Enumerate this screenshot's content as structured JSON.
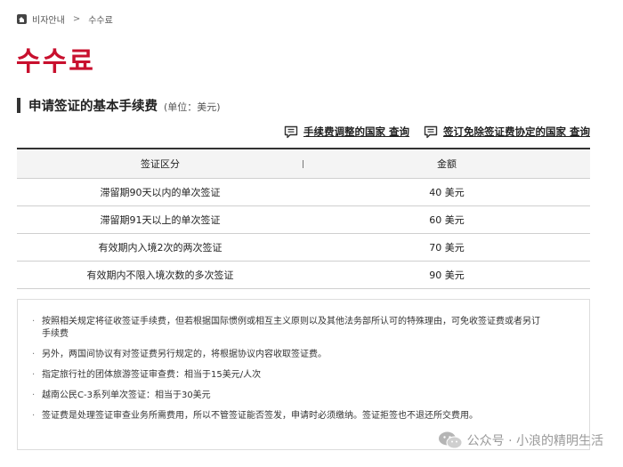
{
  "breadcrumb": {
    "home_icon": "home-icon",
    "item1": "비자안내",
    "separator": ">",
    "item2": "수수료"
  },
  "page_title": "수수료",
  "section": {
    "title": "申请签证的基本手续费",
    "unit": "(单位：美元)"
  },
  "links": [
    {
      "label": "手续费调整的国家 查询",
      "icon": "chat-icon"
    },
    {
      "label": "签订免除签证费协定的国家 查询",
      "icon": "chat-icon"
    }
  ],
  "table": {
    "headers": [
      "签证区分",
      "金额"
    ],
    "rows": [
      [
        "滞留期90天以内的单次签证",
        "40 美元"
      ],
      [
        "滞留期91天以上的单次签证",
        "60 美元"
      ],
      [
        "有效期内入境2次的两次签证",
        "70 美元"
      ],
      [
        "有效期内不限入境次数的多次签证",
        "90 美元"
      ]
    ]
  },
  "notes": [
    "按照相关规定将征收签证手续费，但若根据国际惯例或相互主义原则以及其他法务部所认可的特殊理由，可免收签证费或者另订手续费",
    "另外，两国间协议有对签证费另行规定的，将根据协议内容收取签证费。",
    "指定旅行社的团体旅游签证审查费：相当于15美元/人次",
    "越南公民C-3系列单次签证：相当于30美元",
    "签证费是处理签证审查业务所需费用，所以不管签证能否签发，申请时必须缴纳。签证拒签也不退还所交费用。"
  ],
  "watermark": {
    "icon": "wechat-icon",
    "text": "公众号 · 小浪的精明生活"
  },
  "colors": {
    "title_red": "#c8102e",
    "header_bg": "#f4f4f4"
  }
}
